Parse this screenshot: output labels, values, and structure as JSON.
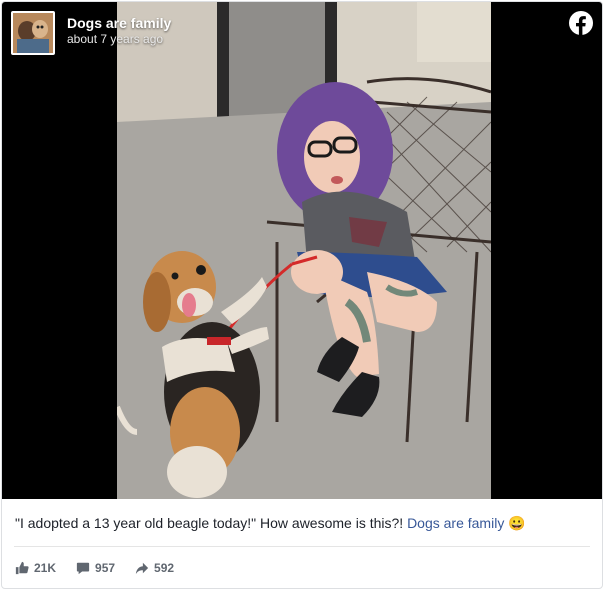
{
  "post": {
    "page_name": "Dogs are family",
    "timestamp": "about 7 years ago",
    "caption_text": "\"I adopted a 13 year old beagle today!\" How awesome is this?! ",
    "caption_link": "Dogs are family",
    "caption_emoji": "😀"
  },
  "stats": {
    "likes": "21K",
    "comments": "957",
    "shares": "592"
  },
  "icons": {
    "brand": "facebook-icon",
    "like": "thumbs-up-icon",
    "comment": "comment-bubble-icon",
    "share": "share-arrow-icon"
  },
  "colors": {
    "link": "#385898",
    "text": "#1d2129",
    "meta": "#606770",
    "media_bg": "#000000"
  }
}
